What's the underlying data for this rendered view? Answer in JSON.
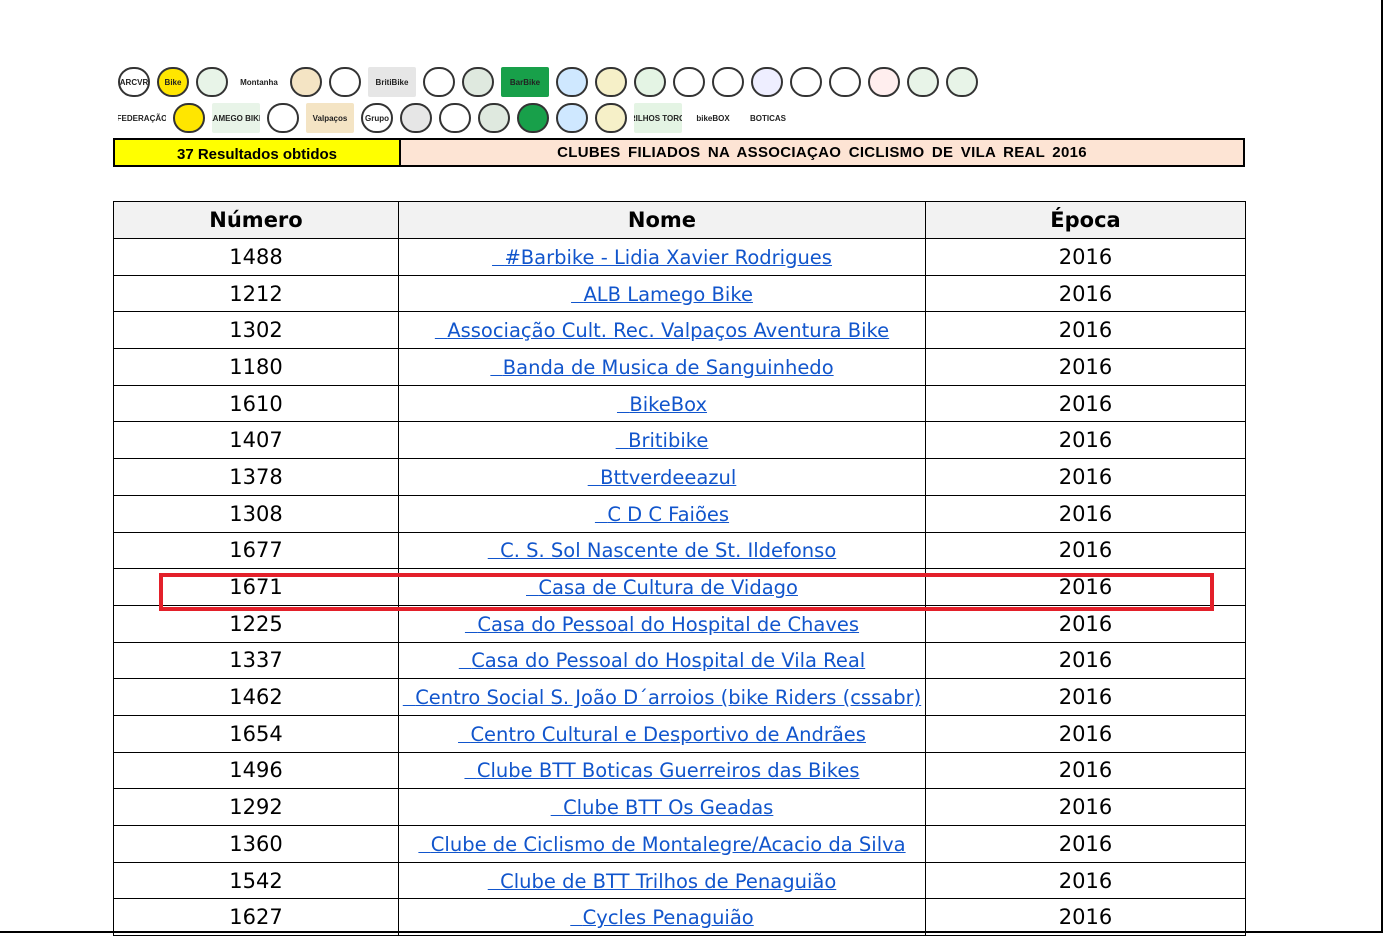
{
  "header": {
    "results_label": "37 Resultados obtidos",
    "title": "CLUBES  FILIADOS  NA  ASSOCIAÇAO  CICLISMO  DE  VILA REAL  2016"
  },
  "logos": {
    "row1": [
      {
        "icon": "arcvr-logo",
        "text": "ARCVR"
      },
      {
        "icon": "bike-logo",
        "text": "Bike"
      },
      {
        "icon": "club-logo",
        "text": ""
      },
      {
        "icon": "montanha-logo",
        "text": "Montanha"
      },
      {
        "icon": "wheel-logo",
        "text": ""
      },
      {
        "icon": "wheel-logo",
        "text": ""
      },
      {
        "icon": "britibike-logo",
        "text": "BritiBike"
      },
      {
        "icon": "casa-pessoal-logo",
        "text": ""
      },
      {
        "icon": "wheel-logo",
        "text": ""
      },
      {
        "icon": "barbike-logo",
        "text": "BarBike"
      },
      {
        "icon": "bike-circle-logo",
        "text": ""
      },
      {
        "icon": "bike-badge-logo",
        "text": ""
      },
      {
        "icon": "wheel-logo",
        "text": ""
      },
      {
        "icon": "club-logo",
        "text": ""
      },
      {
        "icon": "mountain-logo",
        "text": ""
      },
      {
        "icon": "diamond-logo",
        "text": ""
      },
      {
        "icon": "shield-logo",
        "text": ""
      },
      {
        "icon": "cyclist-logo",
        "text": ""
      },
      {
        "icon": "crest-logo",
        "text": ""
      },
      {
        "icon": "green-circle-logo",
        "text": ""
      },
      {
        "icon": "flag-logo",
        "text": ""
      }
    ],
    "row2": [
      {
        "icon": "federacao-logo",
        "text": "FEDERAÇÃO"
      },
      {
        "icon": "bikers-logo",
        "text": ""
      },
      {
        "icon": "lamego-bike-logo",
        "text": "LAMEGO BIKE"
      },
      {
        "icon": "outeiro-logo",
        "text": ""
      },
      {
        "icon": "valpacos-logo",
        "text": "Valpaços"
      },
      {
        "icon": "grupo-ciclo-logo",
        "text": "Grupo"
      },
      {
        "icon": "sporting-logo",
        "text": ""
      },
      {
        "icon": "wave-logo",
        "text": ""
      },
      {
        "icon": "badge-logo",
        "text": ""
      },
      {
        "icon": "bike-photo-logo",
        "text": ""
      },
      {
        "icon": "cyclist-photo-logo",
        "text": ""
      },
      {
        "icon": "casa-cultura-logo",
        "text": ""
      },
      {
        "icon": "trilhos-logo",
        "text": "TRILHOS TORGA"
      },
      {
        "icon": "bikebox-logo",
        "text": "bikeBOX"
      },
      {
        "icon": "boticas-logo",
        "text": "BOTICAS"
      }
    ]
  },
  "table": {
    "columns": [
      "Número",
      "Nome",
      "Época"
    ],
    "rows": [
      {
        "numero": "1488",
        "nome": "#Barbike - Lidia Xavier Rodrigues",
        "epoca": "2016"
      },
      {
        "numero": "1212",
        "nome": "ALB Lamego Bike",
        "epoca": "2016"
      },
      {
        "numero": "1302",
        "nome": "Associação Cult. Rec. Valpaços Aventura Bike",
        "epoca": "2016"
      },
      {
        "numero": "1180",
        "nome": "Banda de Musica de Sanguinhedo",
        "epoca": "2016"
      },
      {
        "numero": "1610",
        "nome": "BikeBox",
        "epoca": "2016"
      },
      {
        "numero": "1407",
        "nome": "Britibike",
        "epoca": "2016"
      },
      {
        "numero": "1378",
        "nome": "Bttverdeeazul",
        "epoca": "2016"
      },
      {
        "numero": "1308",
        "nome": "C D C Faiões",
        "epoca": "2016"
      },
      {
        "numero": "1677",
        "nome": "C. S. Sol Nascente de St. Ildefonso",
        "epoca": "2016"
      },
      {
        "numero": "1671",
        "nome": "Casa de Cultura de Vidago",
        "epoca": "2016"
      },
      {
        "numero": "1225",
        "nome": "Casa do Pessoal do Hospital de Chaves",
        "epoca": "2016"
      },
      {
        "numero": "1337",
        "nome": "Casa do Pessoal do Hospital de Vila Real",
        "epoca": "2016"
      },
      {
        "numero": "1462",
        "nome": "Centro Social S. João D´arroios (bike Riders (cssabr)",
        "epoca": "2016"
      },
      {
        "numero": "1654",
        "nome": "Centro Cultural e Desportivo de Andrães",
        "epoca": "2016"
      },
      {
        "numero": "1496",
        "nome": "Clube BTT Boticas Guerreiros das Bikes",
        "epoca": "2016"
      },
      {
        "numero": "1292",
        "nome": "Clube BTT Os Geadas",
        "epoca": "2016"
      },
      {
        "numero": "1360",
        "nome": "Clube de Ciclismo de Montalegre/Acacio da Silva",
        "epoca": "2016"
      },
      {
        "numero": "1542",
        "nome": "Clube de BTT Trilhos de Penaguião",
        "epoca": "2016"
      },
      {
        "numero": "1627",
        "nome": "Cycles Penaguião",
        "epoca": "2016"
      }
    ]
  },
  "colors": {
    "results_bg": "#ffff00",
    "title_bg": "#fde4d4",
    "link": "#1155cc",
    "highlight": "#e3202a"
  }
}
